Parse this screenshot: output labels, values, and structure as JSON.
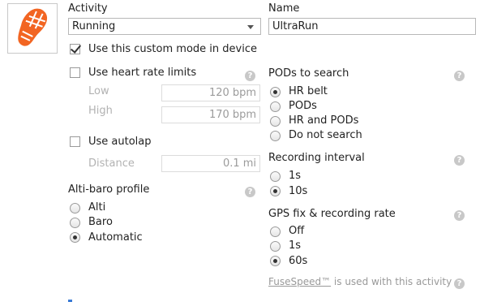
{
  "activity": {
    "label": "Activity",
    "value": "Running",
    "icon": "running-shoe-icon",
    "accent_color": "#f26522"
  },
  "name": {
    "label": "Name",
    "value": "UltraRun"
  },
  "custom_mode": {
    "label": "Use this custom mode in device",
    "checked": true
  },
  "heart_rate": {
    "label": "Use heart rate limits",
    "checked": false,
    "low_label": "Low",
    "low_value": "120",
    "high_label": "High",
    "high_value": "170",
    "unit": "bpm"
  },
  "autolap": {
    "label": "Use autolap",
    "checked": false,
    "distance_label": "Distance",
    "distance_value": "0.1",
    "unit": "mi"
  },
  "altibaro": {
    "label": "Alti-baro profile",
    "options": [
      "Alti",
      "Baro",
      "Automatic"
    ],
    "selected": "Automatic"
  },
  "pods": {
    "label": "PODs to search",
    "options": [
      "HR belt",
      "PODs",
      "HR and PODs",
      "Do not search"
    ],
    "selected": "HR belt"
  },
  "recording": {
    "label": "Recording interval",
    "options": [
      "1s",
      "10s"
    ],
    "selected": "10s"
  },
  "gps": {
    "label": "GPS fix & recording rate",
    "options": [
      "Off",
      "1s",
      "60s"
    ],
    "selected": "60s"
  },
  "fusespeed": {
    "link": "FuseSpeed™",
    "text": " is used with this activity"
  },
  "help_glyph": "?"
}
